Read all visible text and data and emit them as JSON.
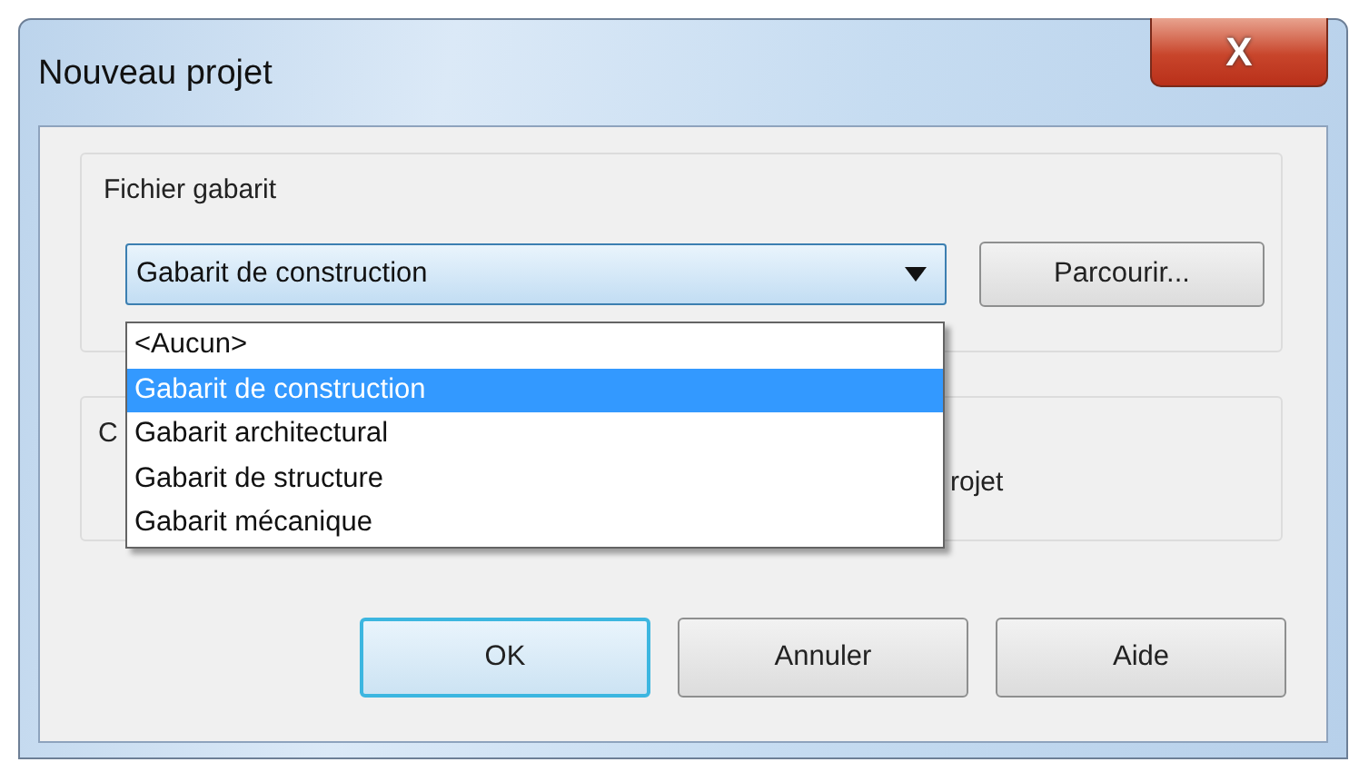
{
  "window": {
    "title": "Nouveau projet",
    "close_glyph": "X"
  },
  "template_group": {
    "label": "Fichier gabarit",
    "combo": {
      "value": "Gabarit de construction",
      "expanded": true
    },
    "browse_button": "Parcourir...",
    "options": [
      {
        "label": "<Aucun>",
        "selected": false
      },
      {
        "label": "Gabarit de construction",
        "selected": true
      },
      {
        "label": "Gabarit architectural",
        "selected": false
      },
      {
        "label": "Gabarit de structure",
        "selected": false
      },
      {
        "label": "Gabarit mécanique",
        "selected": false
      }
    ]
  },
  "second_group": {
    "label": "C",
    "text": "rojet"
  },
  "buttons": [
    {
      "label": "OK",
      "focused": true
    },
    {
      "label": "Annuler",
      "focused": false
    },
    {
      "label": "Aide",
      "focused": false
    }
  ]
}
